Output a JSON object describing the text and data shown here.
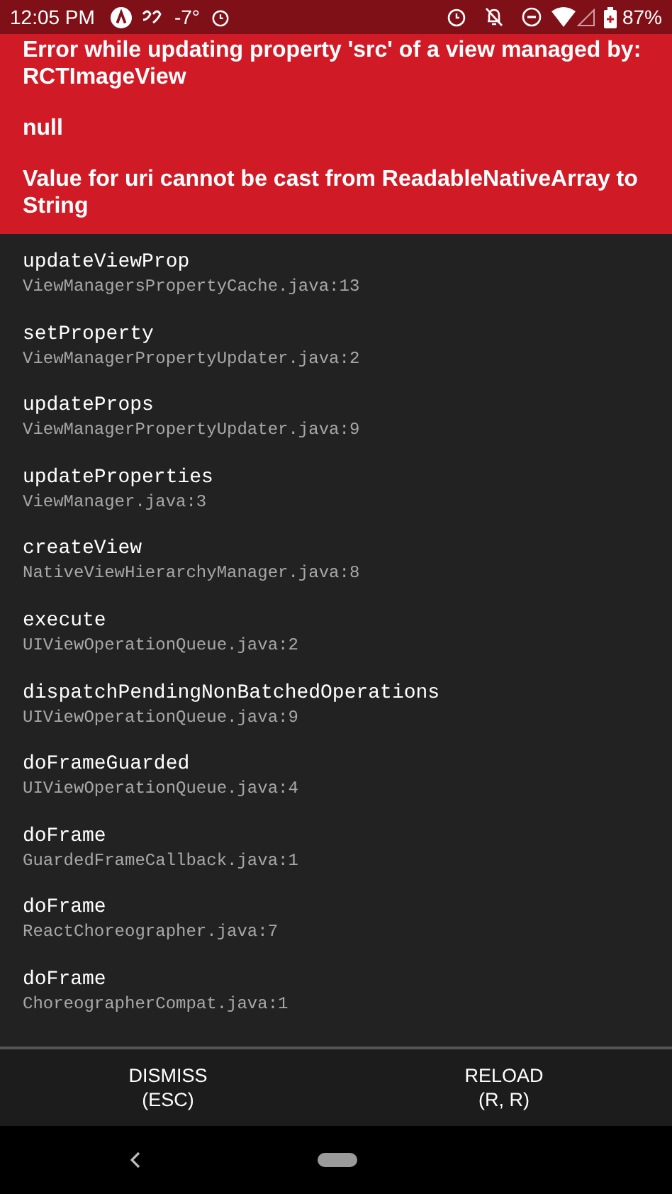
{
  "status_bar": {
    "time": "12:05 PM",
    "temperature": "-7°",
    "battery": "87%"
  },
  "error": {
    "paragraphs": [
      "Error while updating property 'src' of a view managed by: RCTImageView",
      "null",
      "Value for uri cannot be cast from ReadableNativeArray to String"
    ]
  },
  "stack": [
    {
      "method": "updateViewProp",
      "file": "ViewManagersPropertyCache.java:13"
    },
    {
      "method": "setProperty",
      "file": "ViewManagerPropertyUpdater.java:2"
    },
    {
      "method": "updateProps",
      "file": "ViewManagerPropertyUpdater.java:9"
    },
    {
      "method": "updateProperties",
      "file": "ViewManager.java:3"
    },
    {
      "method": "createView",
      "file": "NativeViewHierarchyManager.java:8"
    },
    {
      "method": "execute",
      "file": "UIViewOperationQueue.java:2"
    },
    {
      "method": "dispatchPendingNonBatchedOperations",
      "file": "UIViewOperationQueue.java:9"
    },
    {
      "method": "doFrameGuarded",
      "file": "UIViewOperationQueue.java:4"
    },
    {
      "method": "doFrame",
      "file": "GuardedFrameCallback.java:1"
    },
    {
      "method": "doFrame",
      "file": "ReactChoreographer.java:7"
    },
    {
      "method": "doFrame",
      "file": "ChoreographerCompat.java:1"
    }
  ],
  "buttons": [
    {
      "label": "DISMISS",
      "shortcut": "(ESC)"
    },
    {
      "label": "RELOAD",
      "shortcut": "(R, R)"
    }
  ]
}
